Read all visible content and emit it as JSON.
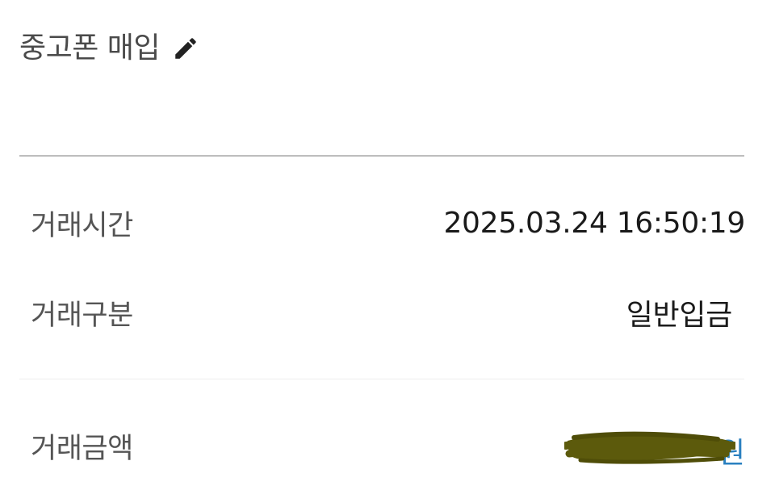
{
  "header": {
    "title": "중고폰 매입",
    "edit_icon": "pencil-icon"
  },
  "details": {
    "rows": [
      {
        "label": "거래시간",
        "value": "2025.03.24 16:50:19"
      },
      {
        "label": "거래구분",
        "value": "일반입금"
      },
      {
        "label": "거래금액",
        "value": "원",
        "redacted": true
      }
    ]
  },
  "colors": {
    "label_text": "#555555",
    "value_text": "#1a1a1a",
    "divider": "#bdbdbd",
    "redaction": "#5c5a0c"
  }
}
